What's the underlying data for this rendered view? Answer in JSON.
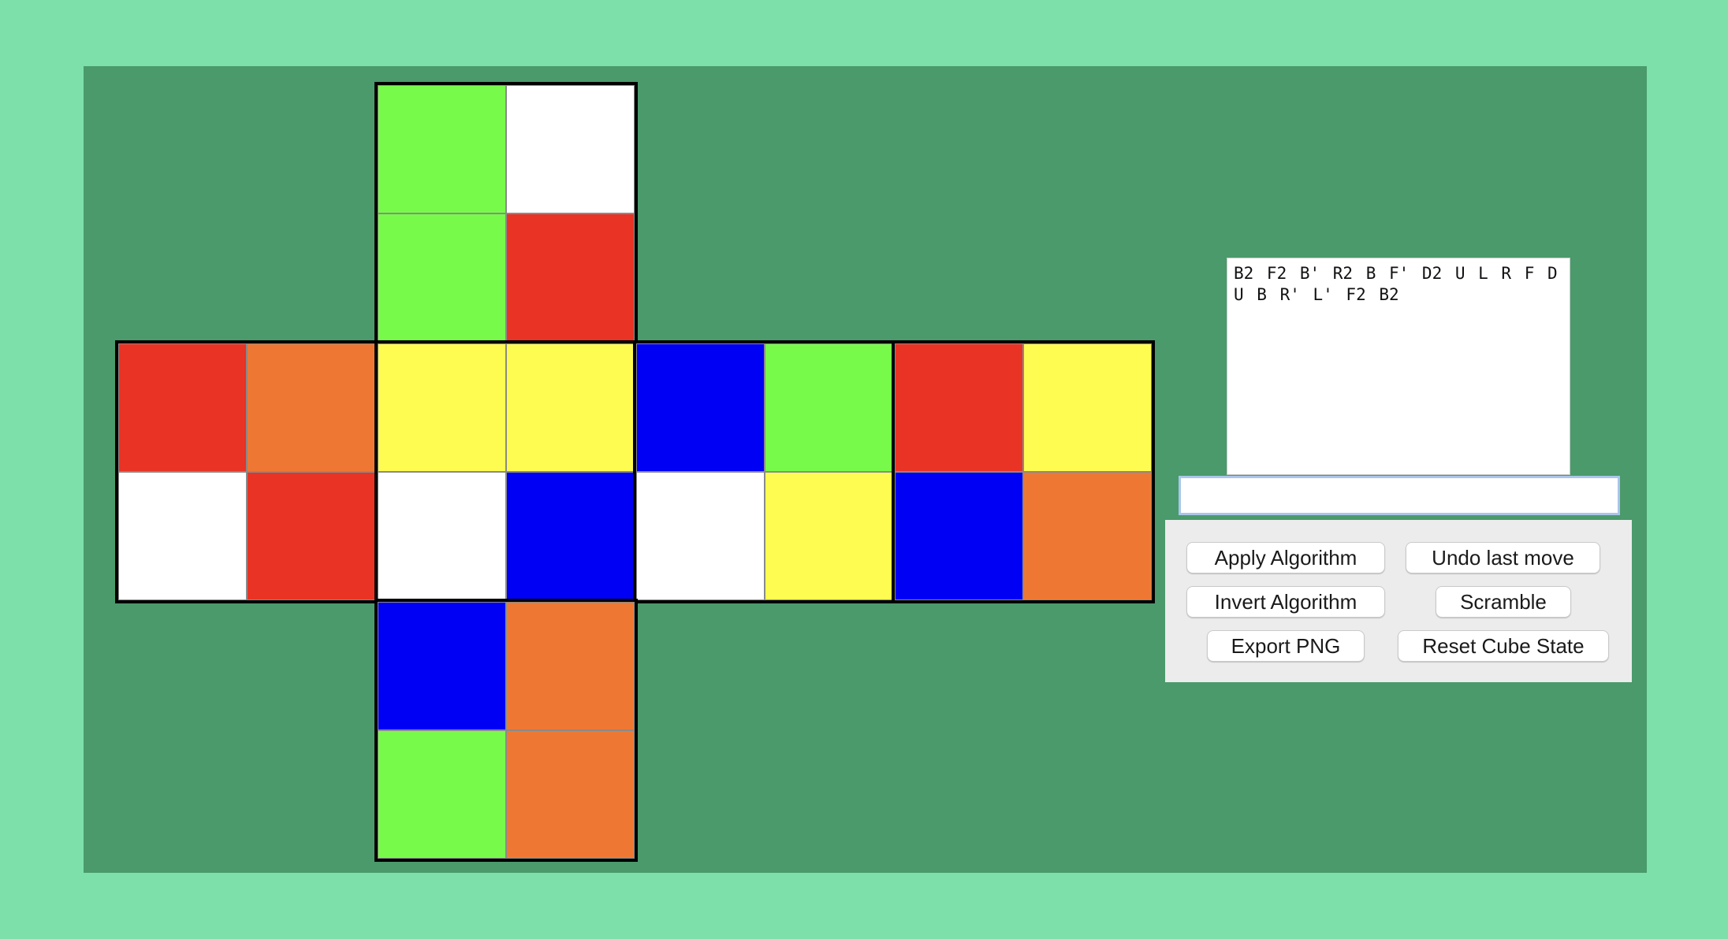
{
  "colors": {
    "background": "#7de0aa",
    "canvas": "#4a9a6b",
    "G": "#78fa4b",
    "W": "#ffffff",
    "R": "#e93324",
    "O": "#ee7833",
    "Y": "#fefc51",
    "B": "#0000f5"
  },
  "cube": {
    "up": [
      "G",
      "W",
      "G",
      "R"
    ],
    "left": [
      "R",
      "O",
      "W",
      "R"
    ],
    "front": [
      "Y",
      "Y",
      "W",
      "B"
    ],
    "right": [
      "B",
      "G",
      "W",
      "Y"
    ],
    "back": [
      "R",
      "Y",
      "B",
      "O"
    ],
    "down": [
      "B",
      "O",
      "G",
      "O"
    ]
  },
  "move_log": "B2 F2 B' R2 B F' D2 U L R F D\nU B R' L' F2 B2",
  "algorithm_input": {
    "value": "",
    "placeholder": ""
  },
  "buttons": {
    "apply": "Apply Algorithm",
    "undo": "Undo last move",
    "invert": "Invert Algorithm",
    "scramble": "Scramble",
    "export": "Export PNG",
    "reset": "Reset Cube State"
  }
}
